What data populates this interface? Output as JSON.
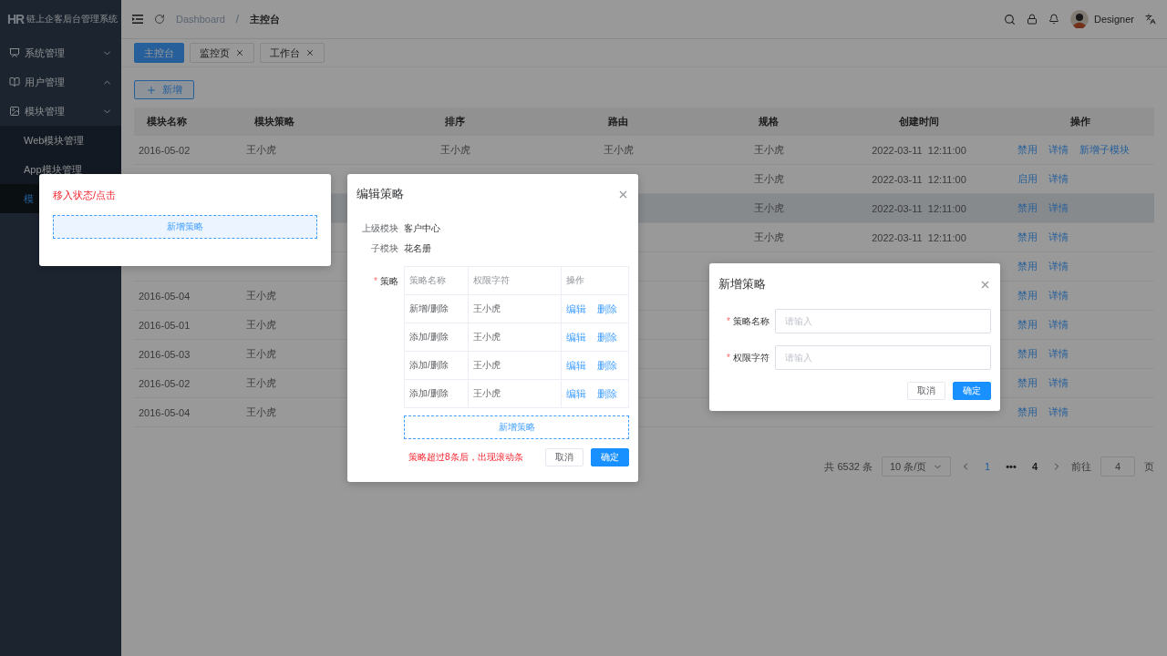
{
  "sidebar": {
    "logo": "HR",
    "title": "链上企客后台管理系统",
    "groups": [
      {
        "label": "系统管理",
        "chevron_up": false
      },
      {
        "label": "用户管理",
        "chevron_up": true
      },
      {
        "label": "模块管理",
        "chevron_up": false,
        "children": [
          {
            "label": "Web模块管理",
            "selected": false
          },
          {
            "label": "App模块管理",
            "selected": false
          },
          {
            "label": "模",
            "selected": true
          }
        ]
      }
    ]
  },
  "header": {
    "breadcrumb": [
      "Dashboard",
      "主控台"
    ],
    "separator": "/",
    "user": "Designer"
  },
  "tabs": [
    {
      "label": "主控台",
      "selected": true,
      "closable": false
    },
    {
      "label": "监控页",
      "selected": false,
      "closable": true
    },
    {
      "label": "工作台",
      "selected": false,
      "closable": true
    }
  ],
  "add_button": "新增",
  "table": {
    "columns": [
      "模块名称",
      "模块策略",
      "排序",
      "路由",
      "规格",
      "创建时间",
      "操作"
    ],
    "rows": [
      {
        "highlighted": false,
        "cells": {
          "name": "2016-05-02",
          "strategy": "王小虎",
          "order": "王小虎",
          "route": "王小虎",
          "spec": "王小虎",
          "created": "2022-03-11  12:11:00"
        },
        "actions": [
          "禁用",
          "详情",
          "新增子模块"
        ]
      },
      {
        "highlighted": false,
        "cells": {
          "spec": "王小虎",
          "created": "2022-03-11  12:11:00"
        },
        "actions": [
          "启用",
          "详情"
        ]
      },
      {
        "highlighted": true,
        "cells": {
          "spec": "王小虎",
          "created": "2022-03-11  12:11:00"
        },
        "actions": [
          "禁用",
          "详情"
        ]
      },
      {
        "highlighted": false,
        "cells": {
          "spec": "王小虎",
          "created": "2022-03-11  12:11:00"
        },
        "actions": [
          "禁用",
          "详情"
        ]
      },
      {
        "highlighted": false,
        "cells": {},
        "actions": [
          "禁用",
          "详情"
        ]
      },
      {
        "highlighted": false,
        "cells": {
          "name": "2016-05-04",
          "strategy": "王小虎"
        },
        "actions": [
          "禁用",
          "详情"
        ]
      },
      {
        "highlighted": false,
        "cells": {
          "name": "2016-05-01",
          "strategy": "王小虎"
        },
        "actions": [
          "禁用",
          "详情"
        ]
      },
      {
        "highlighted": false,
        "cells": {
          "name": "2016-05-03",
          "strategy": "王小虎"
        },
        "actions": [
          "禁用",
          "详情"
        ]
      },
      {
        "highlighted": false,
        "cells": {
          "name": "2016-05-02",
          "strategy": "王小虎"
        },
        "actions": [
          "禁用",
          "详情"
        ]
      },
      {
        "highlighted": false,
        "cells": {
          "name": "2016-05-04",
          "strategy": "王小虎"
        },
        "actions": [
          "禁用",
          "详情"
        ]
      }
    ]
  },
  "pagination": {
    "total": "共 6532 条",
    "page_size": "10 条/页",
    "pages": [
      {
        "label": "1",
        "selected": true
      },
      {
        "label": "•••",
        "selected": false
      },
      {
        "label": "4",
        "selected": false
      }
    ],
    "goto_label": "前往",
    "goto_value": "4",
    "goto_suffix": "页"
  },
  "hover_card": {
    "note": "移入状态/点击",
    "button": "新增策略"
  },
  "edit_dialog": {
    "title": "编辑策略",
    "fields": [
      {
        "label": "上级模块",
        "value": "客户中心"
      },
      {
        "label": "子模块",
        "value": "花名册"
      }
    ],
    "strategy_label": "策略",
    "strategy_mark": "*",
    "columns": [
      "策略名称",
      "权限字符",
      "操作"
    ],
    "rows": [
      {
        "name": "新增/删除",
        "code": "王小虎",
        "actions": [
          "编辑",
          "删除"
        ]
      },
      {
        "name": "添加/删除",
        "code": "王小虎",
        "actions": [
          "编辑",
          "删除"
        ]
      },
      {
        "name": "添加/删除",
        "code": "王小虎",
        "actions": [
          "编辑",
          "删除"
        ]
      },
      {
        "name": "添加/删除",
        "code": "王小虎",
        "actions": [
          "编辑",
          "删除"
        ]
      }
    ],
    "add_button": "新增策略",
    "note": "策略超过8条后，出现滚动条",
    "cancel": "取消",
    "confirm": "确定"
  },
  "add_dialog": {
    "title": "新增策略",
    "fields": [
      {
        "mark": "*",
        "label": "策略名称",
        "placeholder": "请输入"
      },
      {
        "mark": "*",
        "label": "权限字符",
        "placeholder": "请输入"
      }
    ],
    "cancel": "取消",
    "confirm": "确定"
  }
}
